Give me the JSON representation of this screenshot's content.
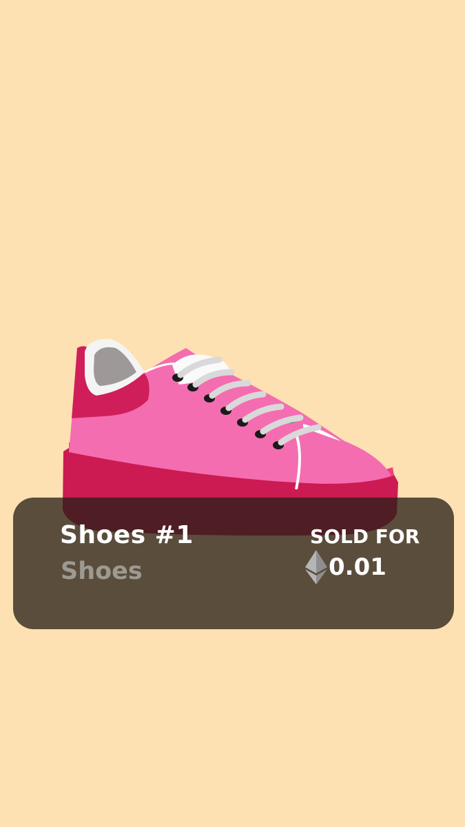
{
  "nft": {
    "title": "Shoes #1",
    "collection": "Shoes"
  },
  "sale": {
    "label": "SOLD FOR",
    "price": "0.01",
    "currency_icon": "ethereum-icon"
  },
  "colors": {
    "background": "#FDE1B2",
    "card": "#4F4538",
    "shoe_body": "#F46DB0",
    "shoe_sole": "#CC1A52",
    "shoe_heel": "#D01E5A",
    "laces": "#D9D9D9",
    "title_text": "#FFFFFF",
    "subtitle_text": "#9E9A92"
  }
}
